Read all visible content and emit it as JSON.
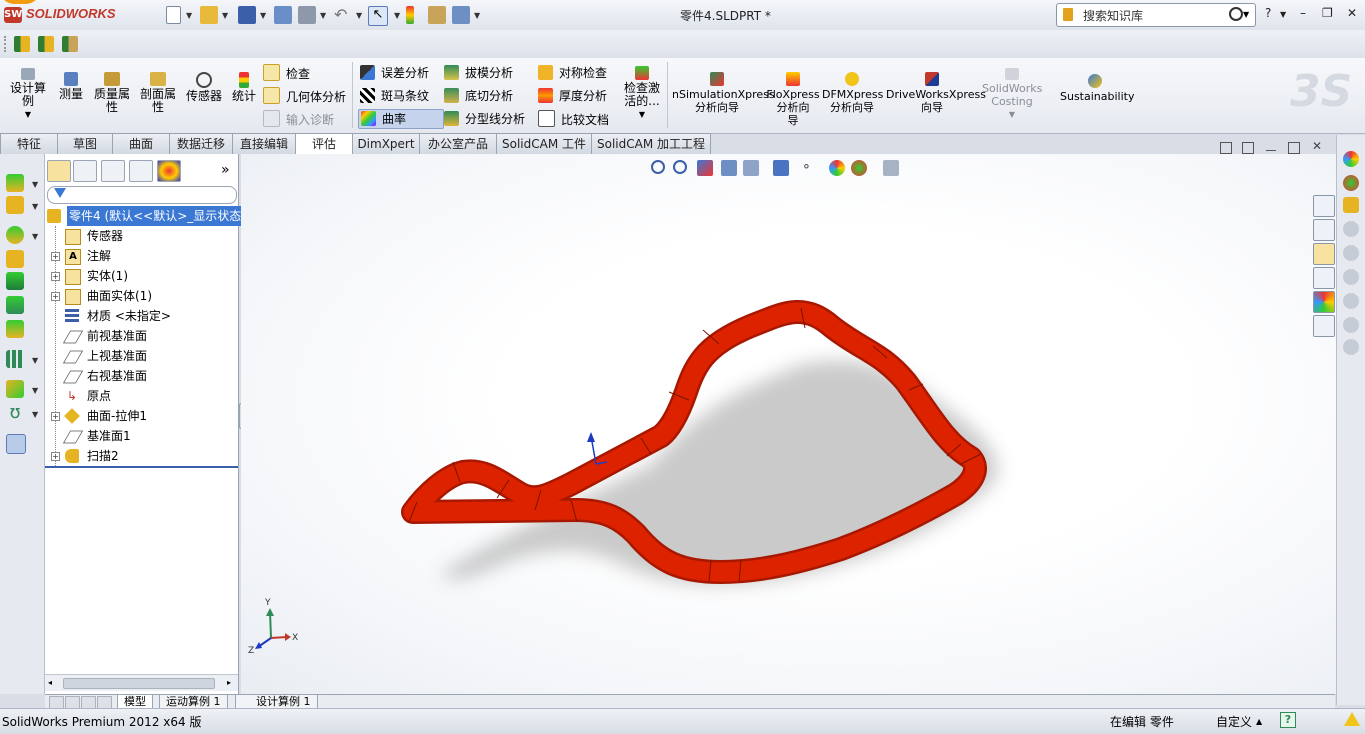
{
  "app": {
    "name": "SOLIDWORKS",
    "document_title": "零件4.SLDPRT *"
  },
  "search": {
    "placeholder": "搜索知识库"
  },
  "window_controls": {
    "help": "?",
    "minimize": "–",
    "restore": "❐",
    "close": "✕"
  },
  "command_manager": {
    "large_buttons": [
      {
        "label": "设计算\n例",
        "icon": "design-study-icon"
      },
      {
        "label": "测量",
        "icon": "measure-icon"
      },
      {
        "label": "质量属\n性",
        "icon": "mass-properties-icon"
      },
      {
        "label": "剖面属\n性",
        "icon": "section-properties-icon"
      },
      {
        "label": "传感器",
        "icon": "sensor-icon"
      },
      {
        "label": "统计",
        "icon": "statistics-icon"
      }
    ],
    "check_group": [
      {
        "label": "检查",
        "icon": "check-icon",
        "enabled": true
      },
      {
        "label": "几何体分析",
        "icon": "geometry-analysis-icon",
        "enabled": true
      },
      {
        "label": "输入诊断",
        "icon": "import-diagnostics-icon",
        "enabled": false
      }
    ],
    "analysis_group1": [
      {
        "label": "误差分析",
        "icon": "deviation-analysis-icon"
      },
      {
        "label": "斑马条纹",
        "icon": "zebra-stripes-icon"
      },
      {
        "label": "曲率",
        "icon": "curvature-icon",
        "active": true
      }
    ],
    "analysis_group2": [
      {
        "label": "拔模分析",
        "icon": "draft-analysis-icon"
      },
      {
        "label": "底切分析",
        "icon": "undercut-analysis-icon"
      },
      {
        "label": "分型线分析",
        "icon": "parting-line-analysis-icon"
      }
    ],
    "analysis_group3": [
      {
        "label": "对称检查",
        "icon": "symmetry-check-icon"
      },
      {
        "label": "厚度分析",
        "icon": "thickness-analysis-icon"
      },
      {
        "label": "比较文档",
        "icon": "compare-documents-icon"
      }
    ],
    "activation_check": {
      "label": "检查激\n活的..."
    },
    "xpress": [
      {
        "label": "nSimulationXpress\n分析向导"
      },
      {
        "label": "FloXpress\n分析向\n导"
      },
      {
        "label": "DFMXpress\n分析向导"
      },
      {
        "label": "DriveWorksXpress\n向导"
      },
      {
        "label": "SolidWorks\nCosting",
        "enabled": false
      },
      {
        "label": "Sustainability"
      }
    ]
  },
  "tabs": [
    "特征",
    "草图",
    "曲面",
    "数据迁移",
    "直接编辑",
    "评估",
    "DimXpert",
    "办公室产品",
    "SolidCAM 工件",
    "SolidCAM 加工工程"
  ],
  "active_tab": "评估",
  "feature_tree": {
    "root": "零件4  (默认<<默认>_显示状态",
    "items": [
      {
        "label": "传感器",
        "expandable": false
      },
      {
        "label": "注解",
        "expandable": true
      },
      {
        "label": "实体(1)",
        "expandable": true
      },
      {
        "label": "曲面实体(1)",
        "expandable": true
      },
      {
        "label": "材质 <未指定>",
        "expandable": false
      },
      {
        "label": "前视基准面",
        "expandable": false
      },
      {
        "label": "上视基准面",
        "expandable": false
      },
      {
        "label": "右视基准面",
        "expandable": false
      },
      {
        "label": "原点",
        "expandable": false
      },
      {
        "label": "曲面-拉伸1",
        "expandable": true
      },
      {
        "label": "基准面1",
        "expandable": false
      },
      {
        "label": "扫描2",
        "expandable": true
      }
    ]
  },
  "triad": {
    "x": "X",
    "y": "Y",
    "z": "Z"
  },
  "bottom_tabs": [
    "模型",
    "运动算例 1",
    "设计算例 1"
  ],
  "active_bottom_tab": "模型",
  "status": {
    "product": "SolidWorks Premium 2012 x64 版",
    "mode": "在编辑 零件",
    "units": "自定义",
    "help": "?"
  },
  "colors": {
    "sweep": "#dd2200",
    "selection": "#3b78d4",
    "brand": "#c0392b"
  }
}
